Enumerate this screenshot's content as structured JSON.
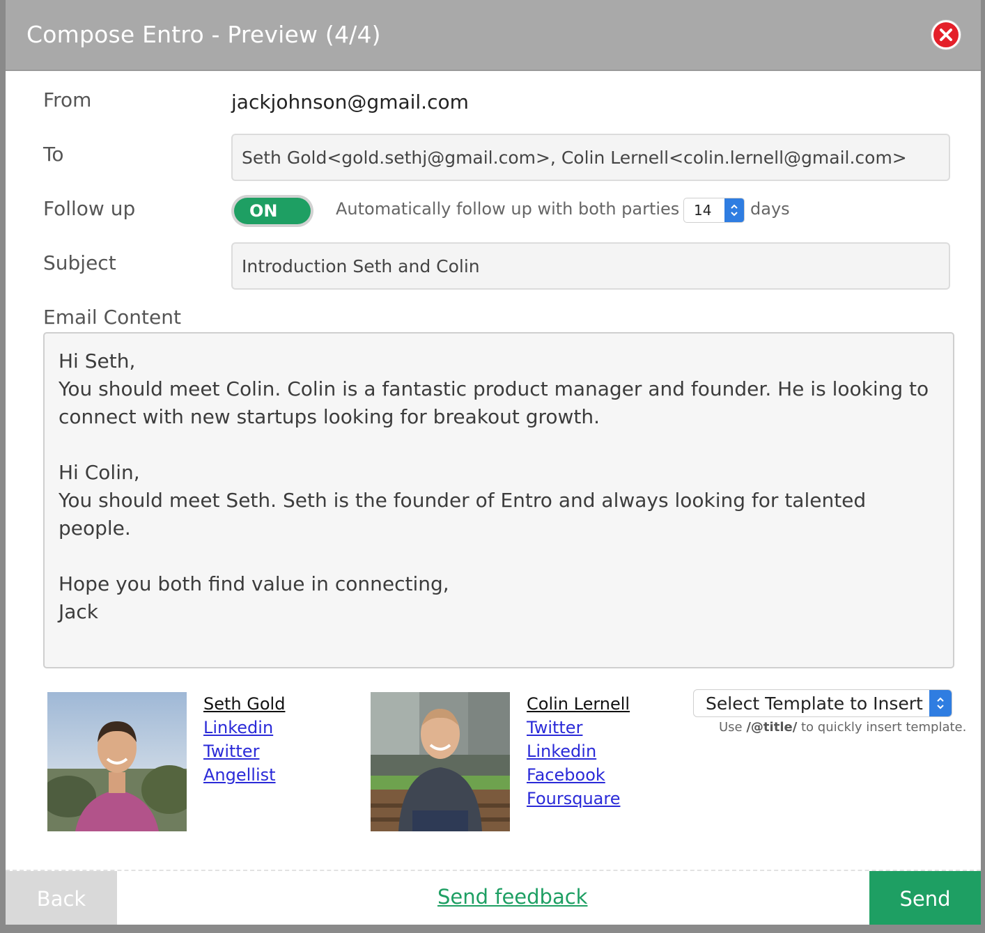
{
  "dialog": {
    "title": "Compose Entro - Preview (4/4)",
    "close_icon": "close-icon"
  },
  "form": {
    "from_label": "From",
    "from_value": "jackjohnson@gmail.com",
    "to_label": "To",
    "to_value": "Seth Gold<gold.sethj@gmail.com>, Colin Lernell<colin.lernell@gmail.com>",
    "followup_label": "Follow up",
    "followup_toggle": "ON",
    "followup_text": "Automatically follow up with both parties in",
    "followup_days": "14",
    "followup_days_suffix": "days",
    "subject_label": "Subject",
    "subject_value": "Introduction Seth and Colin",
    "content_label": "Email Content",
    "content_value": "Hi Seth,\nYou should meet Colin. Colin is a fantastic product manager and founder. He is looking to connect with new startups looking for breakout growth.\n\nHi Colin,\nYou should meet Seth. Seth is the founder of Entro and always looking for talented people.\n\nHope you both find value in connecting,\nJack"
  },
  "contacts": [
    {
      "name": "Seth Gold",
      "links": [
        "Linkedin",
        "Twitter",
        "Angellist"
      ]
    },
    {
      "name": "Colin Lernell",
      "links": [
        "Twitter",
        "Linkedin",
        "Facebook",
        "Foursquare"
      ]
    }
  ],
  "template": {
    "select_label": "Select Template to Insert",
    "hint_prefix": "Use ",
    "hint_code": "/@title/",
    "hint_suffix": " to quickly insert template."
  },
  "footer": {
    "back_label": "Back",
    "feedback_label": "Send feedback",
    "send_label": "Send"
  },
  "colors": {
    "accent_green": "#1e9f63",
    "titlebar_gray": "#a9a9a9",
    "close_red": "#e4202a",
    "link_blue": "#2a2ad8"
  }
}
